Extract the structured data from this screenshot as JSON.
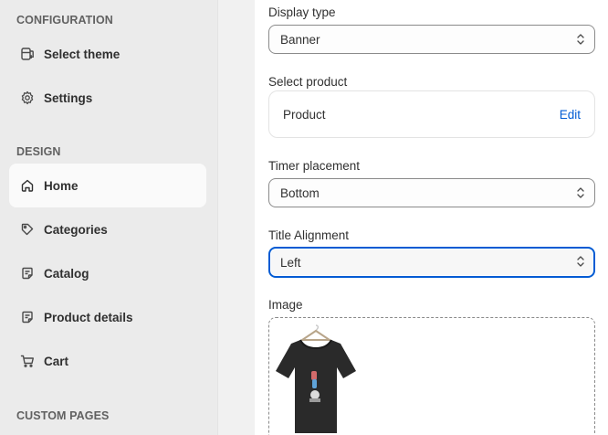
{
  "sidebar": {
    "configuration_title": "CONFIGURATION",
    "design_title": "DESIGN",
    "custom_pages_title": "CUSTOM PAGES",
    "config_items": [
      {
        "label": "Select theme",
        "icon": "theme-icon"
      },
      {
        "label": "Settings",
        "icon": "gear-icon"
      }
    ],
    "design_items": [
      {
        "label": "Home",
        "icon": "home-icon",
        "active": true
      },
      {
        "label": "Categories",
        "icon": "tag-icon"
      },
      {
        "label": "Catalog",
        "icon": "catalog-icon"
      },
      {
        "label": "Product details",
        "icon": "catalog-icon"
      },
      {
        "label": "Cart",
        "icon": "cart-icon"
      }
    ]
  },
  "form": {
    "display_type": {
      "label": "Display type",
      "value": "Banner"
    },
    "select_product": {
      "label": "Select product",
      "product_label": "Product",
      "edit_label": "Edit"
    },
    "timer_placement": {
      "label": "Timer placement",
      "value": "Bottom"
    },
    "title_alignment": {
      "label": "Title Alignment",
      "value": "Left"
    },
    "image": {
      "label": "Image"
    }
  },
  "colors": {
    "sidebar_bg": "#ebebeb",
    "active_item_bg": "#fafafa",
    "link": "#005bd3",
    "focus_border": "#005bd3"
  }
}
